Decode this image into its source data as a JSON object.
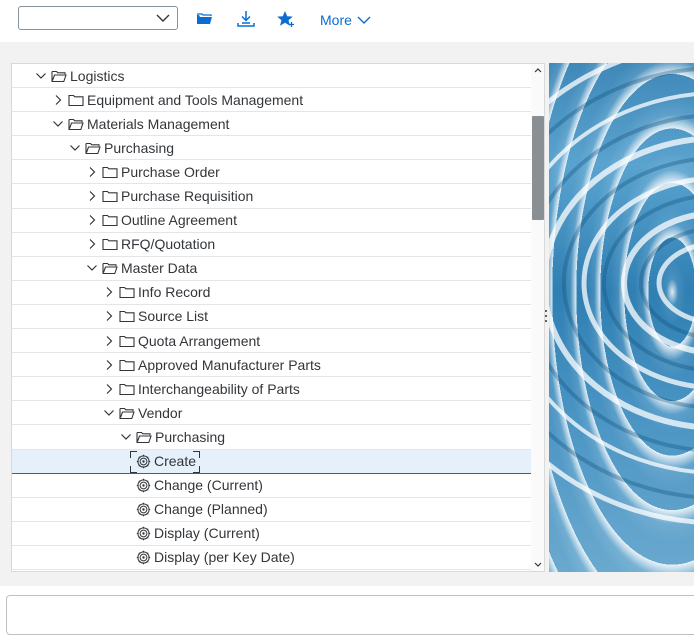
{
  "toolbar": {
    "combo_value": "",
    "more_label": "More",
    "buttons": [
      {
        "icon": "open-folder-icon"
      },
      {
        "icon": "download-icon"
      },
      {
        "icon": "add-favorite-icon"
      }
    ]
  },
  "colors": {
    "accent": "#0a6ed1",
    "text": "#32363a",
    "selected_bg": "#e5f0fa",
    "background": "#f2f2f2"
  },
  "tree": {
    "nodes": [
      {
        "label": "Logistics",
        "level": 0,
        "type": "folder",
        "expanded": true
      },
      {
        "label": "Equipment and Tools Management",
        "level": 1,
        "type": "folder",
        "expanded": false
      },
      {
        "label": "Materials Management",
        "level": 1,
        "type": "folder",
        "expanded": true
      },
      {
        "label": "Purchasing",
        "level": 2,
        "type": "folder",
        "expanded": true
      },
      {
        "label": "Purchase Order",
        "level": 3,
        "type": "folder",
        "expanded": false
      },
      {
        "label": "Purchase Requisition",
        "level": 3,
        "type": "folder",
        "expanded": false
      },
      {
        "label": "Outline Agreement",
        "level": 3,
        "type": "folder",
        "expanded": false
      },
      {
        "label": "RFQ/Quotation",
        "level": 3,
        "type": "folder",
        "expanded": false
      },
      {
        "label": "Master Data",
        "level": 3,
        "type": "folder",
        "expanded": true
      },
      {
        "label": "Info Record",
        "level": 4,
        "type": "folder",
        "expanded": false
      },
      {
        "label": "Source List",
        "level": 4,
        "type": "folder",
        "expanded": false
      },
      {
        "label": "Quota Arrangement",
        "level": 4,
        "type": "folder",
        "expanded": false
      },
      {
        "label": "Approved Manufacturer Parts",
        "level": 4,
        "type": "folder",
        "expanded": false
      },
      {
        "label": "Interchangeability of Parts",
        "level": 4,
        "type": "folder",
        "expanded": false
      },
      {
        "label": "Vendor",
        "level": 4,
        "type": "folder",
        "expanded": true
      },
      {
        "label": "Purchasing",
        "level": 5,
        "type": "folder",
        "expanded": true
      },
      {
        "label": "Create",
        "level": 6,
        "type": "transaction",
        "selected": true
      },
      {
        "label": "Change (Current)",
        "level": 6,
        "type": "transaction"
      },
      {
        "label": "Change (Planned)",
        "level": 6,
        "type": "transaction"
      },
      {
        "label": "Display (Current)",
        "level": 6,
        "type": "transaction"
      },
      {
        "label": "Display (per Key Date)",
        "level": 6,
        "type": "transaction"
      }
    ]
  },
  "status": {
    "message": ""
  }
}
